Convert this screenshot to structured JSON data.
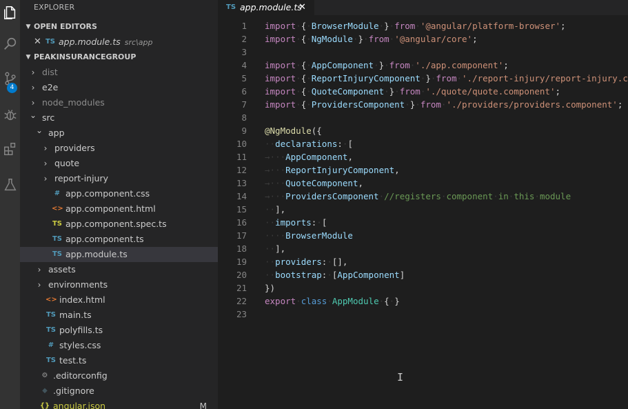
{
  "sidebar": {
    "title": "EXPLORER",
    "open_editors_header": "OPEN EDITORS",
    "open_editor": {
      "icon": "TS",
      "name": "app.module.ts",
      "path": "src\\app"
    },
    "project_header": "PEAKINSURANCEGROUP",
    "tree": [
      {
        "name": "dist",
        "kind": "folder",
        "open": false,
        "level": 0,
        "dim": true
      },
      {
        "name": "e2e",
        "kind": "folder",
        "open": false,
        "level": 0
      },
      {
        "name": "node_modules",
        "kind": "folder",
        "open": false,
        "level": 0,
        "dim": true
      },
      {
        "name": "src",
        "kind": "folder",
        "open": true,
        "level": 0
      },
      {
        "name": "app",
        "kind": "folder",
        "open": true,
        "level": 1
      },
      {
        "name": "providers",
        "kind": "folder",
        "open": false,
        "level": 2
      },
      {
        "name": "quote",
        "kind": "folder",
        "open": false,
        "level": 2
      },
      {
        "name": "report-injury",
        "kind": "folder",
        "open": false,
        "level": 2
      },
      {
        "name": "app.component.css",
        "kind": "css",
        "icon": "#",
        "level": 2
      },
      {
        "name": "app.component.html",
        "kind": "html",
        "icon": "<>",
        "level": 2
      },
      {
        "name": "app.component.spec.ts",
        "kind": "tsy",
        "icon": "TS",
        "level": 2
      },
      {
        "name": "app.component.ts",
        "kind": "ts",
        "icon": "TS",
        "level": 2
      },
      {
        "name": "app.module.ts",
        "kind": "ts",
        "icon": "TS",
        "level": 2,
        "selected": true
      },
      {
        "name": "assets",
        "kind": "folder",
        "open": false,
        "level": 1
      },
      {
        "name": "environments",
        "kind": "folder",
        "open": false,
        "level": 1
      },
      {
        "name": "index.html",
        "kind": "html",
        "icon": "<>",
        "level": 1
      },
      {
        "name": "main.ts",
        "kind": "ts",
        "icon": "TS",
        "level": 1
      },
      {
        "name": "polyfills.ts",
        "kind": "ts",
        "icon": "TS",
        "level": 1
      },
      {
        "name": "styles.css",
        "kind": "css",
        "icon": "#",
        "level": 1
      },
      {
        "name": "test.ts",
        "kind": "ts",
        "icon": "TS",
        "level": 1
      },
      {
        "name": ".editorconfig",
        "kind": "cfg",
        "icon": "⚙",
        "level": 0
      },
      {
        "name": ".gitignore",
        "kind": "git",
        "icon": "◆",
        "level": 0
      },
      {
        "name": "angular.json",
        "kind": "json",
        "icon": "{}",
        "level": 0,
        "status": "M"
      }
    ]
  },
  "activity": {
    "scm_badge": "4"
  },
  "tab": {
    "icon": "TS",
    "name": "app.module.ts",
    "close": "✕"
  },
  "editor": {
    "lines": [
      [
        [
          "k",
          "import"
        ],
        [
          "",
          "·{·"
        ],
        [
          "p",
          "BrowserModule"
        ],
        [
          "",
          "·}·"
        ],
        [
          "k",
          "from"
        ],
        [
          "",
          "·"
        ],
        [
          "s",
          "'@angular/platform-browser'"
        ],
        [
          "",
          ";"
        ]
      ],
      [
        [
          "k",
          "import"
        ],
        [
          "",
          "·{·"
        ],
        [
          "p",
          "NgModule"
        ],
        [
          "",
          "·}·"
        ],
        [
          "k",
          "from"
        ],
        [
          "",
          "·"
        ],
        [
          "s",
          "'@angular/core'"
        ],
        [
          "",
          ";"
        ]
      ],
      [],
      [
        [
          "k",
          "import"
        ],
        [
          "",
          "·{·"
        ],
        [
          "p",
          "AppComponent"
        ],
        [
          "",
          "·}·"
        ],
        [
          "k",
          "from"
        ],
        [
          "",
          "·"
        ],
        [
          "s",
          "'./app.component'"
        ],
        [
          "",
          ";"
        ]
      ],
      [
        [
          "k",
          "import"
        ],
        [
          "",
          "·{·"
        ],
        [
          "p",
          "ReportInjuryComponent"
        ],
        [
          "",
          "·}·"
        ],
        [
          "k",
          "from"
        ],
        [
          "",
          "·"
        ],
        [
          "s",
          "'./report-injury/report-injury.component'"
        ],
        [
          "",
          ";"
        ]
      ],
      [
        [
          "k",
          "import"
        ],
        [
          "",
          "·{·"
        ],
        [
          "p",
          "QuoteComponent"
        ],
        [
          "",
          "·}·"
        ],
        [
          "k",
          "from"
        ],
        [
          "",
          "·"
        ],
        [
          "s",
          "'./quote/quote.component'"
        ],
        [
          "",
          ";"
        ]
      ],
      [
        [
          "k",
          "import"
        ],
        [
          "",
          "·{·"
        ],
        [
          "p",
          "ProvidersComponent"
        ],
        [
          "",
          "·}·"
        ],
        [
          "k",
          "from"
        ],
        [
          "",
          "·"
        ],
        [
          "s",
          "'./providers/providers.component'"
        ],
        [
          "",
          ";"
        ]
      ],
      [],
      [
        [
          "f",
          "@NgModule"
        ],
        [
          "",
          "({"
        ]
      ],
      [
        [
          "w",
          "··"
        ],
        [
          "p",
          "declarations"
        ],
        [
          "",
          ":·["
        ]
      ],
      [
        [
          "w",
          "→·"
        ],
        [
          "",
          "··"
        ],
        [
          "p",
          "AppComponent"
        ],
        [
          "",
          ","
        ]
      ],
      [
        [
          "w",
          "→·"
        ],
        [
          "",
          "··"
        ],
        [
          "p",
          "ReportInjuryComponent"
        ],
        [
          "",
          ","
        ]
      ],
      [
        [
          "w",
          "→·"
        ],
        [
          "",
          "··"
        ],
        [
          "p",
          "QuoteComponent"
        ],
        [
          "",
          ","
        ]
      ],
      [
        [
          "w",
          "→·"
        ],
        [
          "",
          "··"
        ],
        [
          "p",
          "ProvidersComponent"
        ],
        [
          "",
          "·"
        ],
        [
          "c",
          "//registers·component·in·this·module"
        ]
      ],
      [
        [
          "w",
          "··"
        ],
        [
          "",
          "],"
        ]
      ],
      [
        [
          "w",
          "··"
        ],
        [
          "p",
          "imports"
        ],
        [
          "",
          ":·["
        ]
      ],
      [
        [
          "w",
          "····"
        ],
        [
          "p",
          "BrowserModule"
        ]
      ],
      [
        [
          "w",
          "··"
        ],
        [
          "",
          "],"
        ]
      ],
      [
        [
          "w",
          "··"
        ],
        [
          "p",
          "providers"
        ],
        [
          "",
          ":·[],"
        ]
      ],
      [
        [
          "w",
          "··"
        ],
        [
          "p",
          "bootstrap"
        ],
        [
          "",
          ":·["
        ],
        [
          "p",
          "AppComponent"
        ],
        [
          "",
          "]"
        ]
      ],
      [
        [
          "",
          "})"
        ]
      ],
      [
        [
          "k",
          "export"
        ],
        [
          "",
          "·"
        ],
        [
          "b",
          "class"
        ],
        [
          "",
          "·"
        ],
        [
          "t",
          "AppModule"
        ],
        [
          "",
          "·{·}"
        ]
      ],
      []
    ],
    "cursor": "I"
  }
}
